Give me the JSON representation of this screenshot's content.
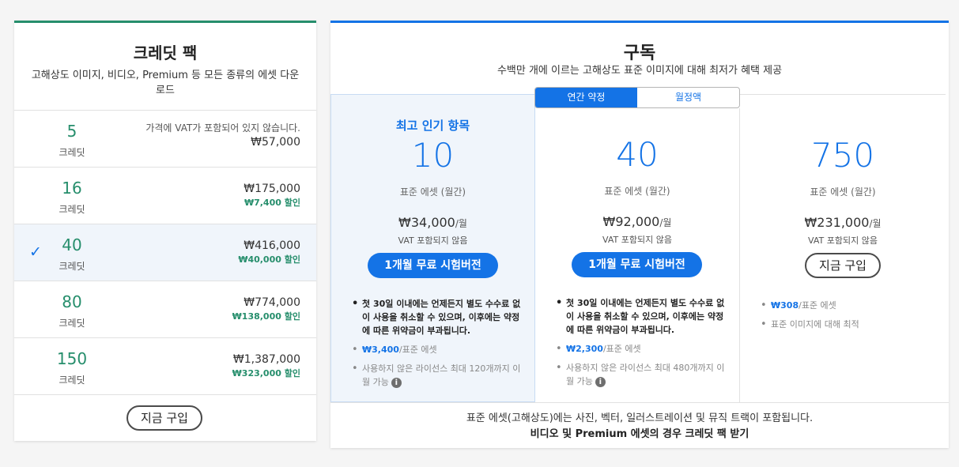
{
  "credit_pack": {
    "title": "크레딧 팩",
    "subtitle": "고해상도 이미지, 비디오, Premium 등 모든 종류의 에셋 다운로드",
    "unit_label": "크레딧",
    "vat_note": "가격에 VAT가 포함되어 있지 않습니다.",
    "selected_icon": "checkmark-icon",
    "rows": [
      {
        "credits": "5",
        "price": "₩57,000",
        "discount": "",
        "discount_suffix": "",
        "selected": false
      },
      {
        "credits": "16",
        "price": "₩175,000",
        "discount": "₩7,400",
        "discount_suffix": "할인",
        "selected": false
      },
      {
        "credits": "40",
        "price": "₩416,000",
        "discount": "₩40,000",
        "discount_suffix": "할인",
        "selected": true
      },
      {
        "credits": "80",
        "price": "₩774,000",
        "discount": "₩138,000",
        "discount_suffix": "할인",
        "selected": false
      },
      {
        "credits": "150",
        "price": "₩1,387,000",
        "discount": "₩323,000",
        "discount_suffix": "할인",
        "selected": false
      }
    ],
    "buy_label": "지금 구입"
  },
  "subscription": {
    "title": "구독",
    "subtitle": "수백만 개에 이르는 고해상도 표준 이미지에 대해 최저가 혜택 제공",
    "toggle": {
      "annual_label": "연간 약정",
      "monthly_label": "월정액",
      "active": "annual"
    },
    "plans": [
      {
        "badge": "최고 인기 항목",
        "assets": "10",
        "assets_label": "표준 에셋 (월간)",
        "price": "₩34,000",
        "per": "/월",
        "vat": "VAT 포함되지 않음",
        "cta": "1개월 무료 시험버전",
        "bullet_terms": "첫 30일 이내에는 언제든지 별도 수수료 없이 사용을 취소할 수 있으며, 이후에는 약정에 따른 위약금이 부과됩니다.",
        "per_asset": "₩3,400",
        "per_asset_suffix": "/표준 에셋",
        "rollover": "사용하지 않은 라이선스 최대 120개까지 이월 가능"
      },
      {
        "assets": "40",
        "assets_label": "표준 에셋 (월간)",
        "price": "₩92,000",
        "per": "/월",
        "vat": "VAT 포함되지 않음",
        "cta": "1개월 무료 시험버전",
        "bullet_terms": "첫 30일 이내에는 언제든지 별도 수수료 없이 사용을 취소할 수 있으며, 이후에는 약정에 따른 위약금이 부과됩니다.",
        "per_asset": "₩2,300",
        "per_asset_suffix": "/표준 에셋",
        "rollover": "사용하지 않은 라이선스 최대 480개까지 이월 가능"
      },
      {
        "assets": "750",
        "assets_label": "표준 에셋 (월간)",
        "price": "₩231,000",
        "per": "/월",
        "vat": "VAT 포함되지 않음",
        "cta": "지금 구입",
        "per_asset": "₩308",
        "per_asset_suffix": "/표준 에셋",
        "best_for": "표준 이미지에 대해 최적"
      }
    ],
    "footer_line1": "표준 에셋(고해상도)에는 사진, 벡터, 일러스트레이션 및 뮤직 트랙이 포함됩니다.",
    "footer_line2": "비디오 및 Premium 에셋의 경우 크레딧 팩 받기"
  },
  "colors": {
    "accent_blue": "#1473e6",
    "accent_green": "#268e6c"
  }
}
